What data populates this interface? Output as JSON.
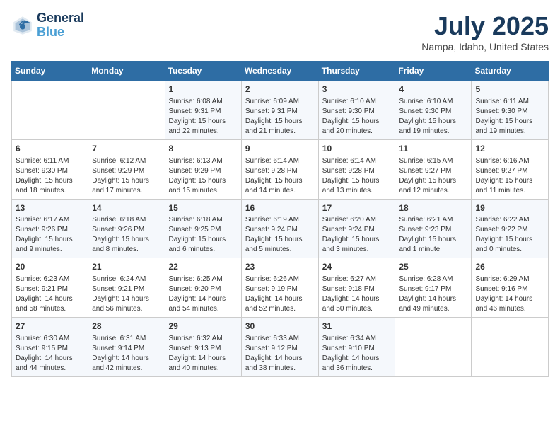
{
  "header": {
    "logo_line1": "General",
    "logo_line2": "Blue",
    "month": "July 2025",
    "location": "Nampa, Idaho, United States"
  },
  "days_of_week": [
    "Sunday",
    "Monday",
    "Tuesday",
    "Wednesday",
    "Thursday",
    "Friday",
    "Saturday"
  ],
  "weeks": [
    [
      {
        "day": "",
        "data": ""
      },
      {
        "day": "",
        "data": ""
      },
      {
        "day": "1",
        "data": "Sunrise: 6:08 AM\nSunset: 9:31 PM\nDaylight: 15 hours and 22 minutes."
      },
      {
        "day": "2",
        "data": "Sunrise: 6:09 AM\nSunset: 9:31 PM\nDaylight: 15 hours and 21 minutes."
      },
      {
        "day": "3",
        "data": "Sunrise: 6:10 AM\nSunset: 9:30 PM\nDaylight: 15 hours and 20 minutes."
      },
      {
        "day": "4",
        "data": "Sunrise: 6:10 AM\nSunset: 9:30 PM\nDaylight: 15 hours and 19 minutes."
      },
      {
        "day": "5",
        "data": "Sunrise: 6:11 AM\nSunset: 9:30 PM\nDaylight: 15 hours and 19 minutes."
      }
    ],
    [
      {
        "day": "6",
        "data": "Sunrise: 6:11 AM\nSunset: 9:30 PM\nDaylight: 15 hours and 18 minutes."
      },
      {
        "day": "7",
        "data": "Sunrise: 6:12 AM\nSunset: 9:29 PM\nDaylight: 15 hours and 17 minutes."
      },
      {
        "day": "8",
        "data": "Sunrise: 6:13 AM\nSunset: 9:29 PM\nDaylight: 15 hours and 15 minutes."
      },
      {
        "day": "9",
        "data": "Sunrise: 6:14 AM\nSunset: 9:28 PM\nDaylight: 15 hours and 14 minutes."
      },
      {
        "day": "10",
        "data": "Sunrise: 6:14 AM\nSunset: 9:28 PM\nDaylight: 15 hours and 13 minutes."
      },
      {
        "day": "11",
        "data": "Sunrise: 6:15 AM\nSunset: 9:27 PM\nDaylight: 15 hours and 12 minutes."
      },
      {
        "day": "12",
        "data": "Sunrise: 6:16 AM\nSunset: 9:27 PM\nDaylight: 15 hours and 11 minutes."
      }
    ],
    [
      {
        "day": "13",
        "data": "Sunrise: 6:17 AM\nSunset: 9:26 PM\nDaylight: 15 hours and 9 minutes."
      },
      {
        "day": "14",
        "data": "Sunrise: 6:18 AM\nSunset: 9:26 PM\nDaylight: 15 hours and 8 minutes."
      },
      {
        "day": "15",
        "data": "Sunrise: 6:18 AM\nSunset: 9:25 PM\nDaylight: 15 hours and 6 minutes."
      },
      {
        "day": "16",
        "data": "Sunrise: 6:19 AM\nSunset: 9:24 PM\nDaylight: 15 hours and 5 minutes."
      },
      {
        "day": "17",
        "data": "Sunrise: 6:20 AM\nSunset: 9:24 PM\nDaylight: 15 hours and 3 minutes."
      },
      {
        "day": "18",
        "data": "Sunrise: 6:21 AM\nSunset: 9:23 PM\nDaylight: 15 hours and 1 minute."
      },
      {
        "day": "19",
        "data": "Sunrise: 6:22 AM\nSunset: 9:22 PM\nDaylight: 15 hours and 0 minutes."
      }
    ],
    [
      {
        "day": "20",
        "data": "Sunrise: 6:23 AM\nSunset: 9:21 PM\nDaylight: 14 hours and 58 minutes."
      },
      {
        "day": "21",
        "data": "Sunrise: 6:24 AM\nSunset: 9:21 PM\nDaylight: 14 hours and 56 minutes."
      },
      {
        "day": "22",
        "data": "Sunrise: 6:25 AM\nSunset: 9:20 PM\nDaylight: 14 hours and 54 minutes."
      },
      {
        "day": "23",
        "data": "Sunrise: 6:26 AM\nSunset: 9:19 PM\nDaylight: 14 hours and 52 minutes."
      },
      {
        "day": "24",
        "data": "Sunrise: 6:27 AM\nSunset: 9:18 PM\nDaylight: 14 hours and 50 minutes."
      },
      {
        "day": "25",
        "data": "Sunrise: 6:28 AM\nSunset: 9:17 PM\nDaylight: 14 hours and 49 minutes."
      },
      {
        "day": "26",
        "data": "Sunrise: 6:29 AM\nSunset: 9:16 PM\nDaylight: 14 hours and 46 minutes."
      }
    ],
    [
      {
        "day": "27",
        "data": "Sunrise: 6:30 AM\nSunset: 9:15 PM\nDaylight: 14 hours and 44 minutes."
      },
      {
        "day": "28",
        "data": "Sunrise: 6:31 AM\nSunset: 9:14 PM\nDaylight: 14 hours and 42 minutes."
      },
      {
        "day": "29",
        "data": "Sunrise: 6:32 AM\nSunset: 9:13 PM\nDaylight: 14 hours and 40 minutes."
      },
      {
        "day": "30",
        "data": "Sunrise: 6:33 AM\nSunset: 9:12 PM\nDaylight: 14 hours and 38 minutes."
      },
      {
        "day": "31",
        "data": "Sunrise: 6:34 AM\nSunset: 9:10 PM\nDaylight: 14 hours and 36 minutes."
      },
      {
        "day": "",
        "data": ""
      },
      {
        "day": "",
        "data": ""
      }
    ]
  ]
}
